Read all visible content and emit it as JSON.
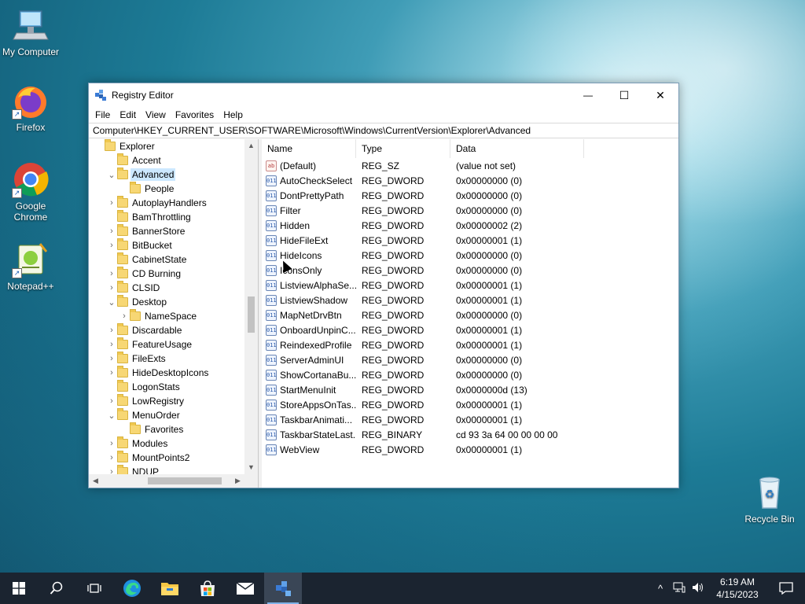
{
  "desktop": {
    "icons": [
      {
        "label": "My Computer"
      },
      {
        "label": "Firefox"
      },
      {
        "label": "Google Chrome"
      },
      {
        "label": "Notepad++"
      },
      {
        "label": "Recycle Bin"
      }
    ]
  },
  "window": {
    "title": "Registry Editor",
    "controls": {
      "minimize": "—",
      "maximize": "☐",
      "close": "✕"
    },
    "menu": [
      "File",
      "Edit",
      "View",
      "Favorites",
      "Help"
    ],
    "address": "Computer\\HKEY_CURRENT_USER\\SOFTWARE\\Microsoft\\Windows\\CurrentVersion\\Explorer\\Advanced",
    "tree": [
      {
        "label": "Explorer",
        "chevron": "",
        "indent": 0
      },
      {
        "label": "Accent",
        "chevron": "",
        "indent": 1
      },
      {
        "label": "Advanced",
        "chevron": "⌄",
        "indent": 1,
        "selected": true
      },
      {
        "label": "People",
        "chevron": "",
        "indent": 2
      },
      {
        "label": "AutoplayHandlers",
        "chevron": "›",
        "indent": 1
      },
      {
        "label": "BamThrottling",
        "chevron": "",
        "indent": 1
      },
      {
        "label": "BannerStore",
        "chevron": "›",
        "indent": 1
      },
      {
        "label": "BitBucket",
        "chevron": "›",
        "indent": 1
      },
      {
        "label": "CabinetState",
        "chevron": "",
        "indent": 1
      },
      {
        "label": "CD Burning",
        "chevron": "›",
        "indent": 1
      },
      {
        "label": "CLSID",
        "chevron": "›",
        "indent": 1
      },
      {
        "label": "Desktop",
        "chevron": "⌄",
        "indent": 1
      },
      {
        "label": "NameSpace",
        "chevron": "›",
        "indent": 2
      },
      {
        "label": "Discardable",
        "chevron": "›",
        "indent": 1
      },
      {
        "label": "FeatureUsage",
        "chevron": "›",
        "indent": 1
      },
      {
        "label": "FileExts",
        "chevron": "›",
        "indent": 1
      },
      {
        "label": "HideDesktopIcons",
        "chevron": "›",
        "indent": 1
      },
      {
        "label": "LogonStats",
        "chevron": "",
        "indent": 1
      },
      {
        "label": "LowRegistry",
        "chevron": "›",
        "indent": 1
      },
      {
        "label": "MenuOrder",
        "chevron": "⌄",
        "indent": 1
      },
      {
        "label": "Favorites",
        "chevron": "",
        "indent": 2
      },
      {
        "label": "Modules",
        "chevron": "›",
        "indent": 1
      },
      {
        "label": "MountPoints2",
        "chevron": "›",
        "indent": 1
      },
      {
        "label": "NDUP",
        "chevron": "›",
        "indent": 1
      }
    ],
    "columns": {
      "name": "Name",
      "type": "Type",
      "data": "Data"
    },
    "values": [
      {
        "name": "(Default)",
        "type": "REG_SZ",
        "data": "(value not set)",
        "icon": "ab"
      },
      {
        "name": "AutoCheckSelect",
        "type": "REG_DWORD",
        "data": "0x00000000 (0)",
        "icon": "011"
      },
      {
        "name": "DontPrettyPath",
        "type": "REG_DWORD",
        "data": "0x00000000 (0)",
        "icon": "011"
      },
      {
        "name": "Filter",
        "type": "REG_DWORD",
        "data": "0x00000000 (0)",
        "icon": "011"
      },
      {
        "name": "Hidden",
        "type": "REG_DWORD",
        "data": "0x00000002 (2)",
        "icon": "011"
      },
      {
        "name": "HideFileExt",
        "type": "REG_DWORD",
        "data": "0x00000001 (1)",
        "icon": "011"
      },
      {
        "name": "HideIcons",
        "type": "REG_DWORD",
        "data": "0x00000000 (0)",
        "icon": "011"
      },
      {
        "name": "IconsOnly",
        "type": "REG_DWORD",
        "data": "0x00000000 (0)",
        "icon": "011"
      },
      {
        "name": "ListviewAlphaSe...",
        "type": "REG_DWORD",
        "data": "0x00000001 (1)",
        "icon": "011"
      },
      {
        "name": "ListviewShadow",
        "type": "REG_DWORD",
        "data": "0x00000001 (1)",
        "icon": "011"
      },
      {
        "name": "MapNetDrvBtn",
        "type": "REG_DWORD",
        "data": "0x00000000 (0)",
        "icon": "011"
      },
      {
        "name": "OnboardUnpinC...",
        "type": "REG_DWORD",
        "data": "0x00000001 (1)",
        "icon": "011"
      },
      {
        "name": "ReindexedProfile",
        "type": "REG_DWORD",
        "data": "0x00000001 (1)",
        "icon": "011"
      },
      {
        "name": "ServerAdminUI",
        "type": "REG_DWORD",
        "data": "0x00000000 (0)",
        "icon": "011"
      },
      {
        "name": "ShowCortanaBu...",
        "type": "REG_DWORD",
        "data": "0x00000000 (0)",
        "icon": "011"
      },
      {
        "name": "StartMenuInit",
        "type": "REG_DWORD",
        "data": "0x0000000d (13)",
        "icon": "011"
      },
      {
        "name": "StoreAppsOnTas...",
        "type": "REG_DWORD",
        "data": "0x00000001 (1)",
        "icon": "011"
      },
      {
        "name": "TaskbarAnimati...",
        "type": "REG_DWORD",
        "data": "0x00000001 (1)",
        "icon": "011"
      },
      {
        "name": "TaskbarStateLast...",
        "type": "REG_BINARY",
        "data": "cd 93 3a 64 00 00 00 00",
        "icon": "011"
      },
      {
        "name": "WebView",
        "type": "REG_DWORD",
        "data": "0x00000001 (1)",
        "icon": "011"
      }
    ]
  },
  "taskbar": {
    "pinned": [
      "start-icon",
      "search-icon",
      "task-view-icon",
      "edge-icon",
      "file-explorer-icon",
      "store-icon",
      "mail-icon",
      "registry-editor-icon"
    ],
    "tray": {
      "chevron": "^",
      "time": "6:19 AM",
      "date": "4/15/2023"
    }
  },
  "colors": {
    "accent": "#0078d7",
    "selection": "#cce8ff",
    "taskbar": "#1b2430",
    "folder": "#f7d774"
  }
}
